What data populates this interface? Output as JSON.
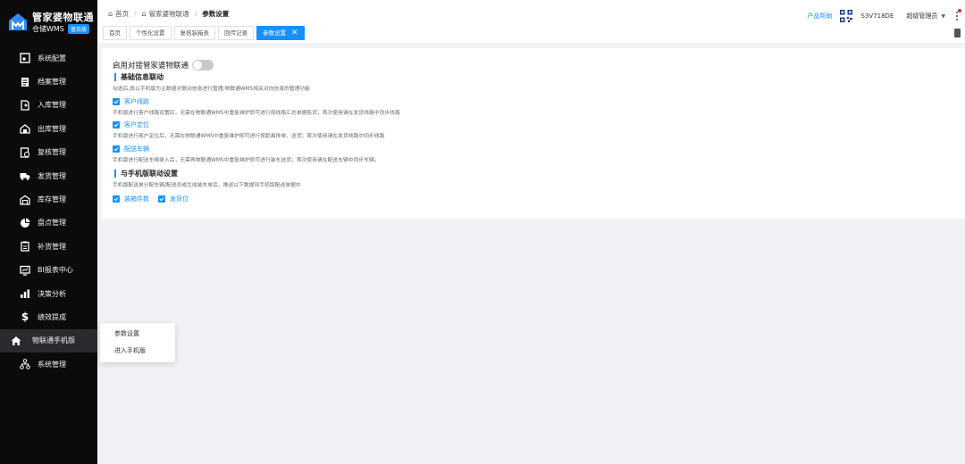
{
  "brand": {
    "title": "管家婆物联通",
    "subtitle": "仓储WMS",
    "badge": "普及版"
  },
  "sidebar": {
    "items": [
      {
        "label": "系统配置",
        "icon": "settings-icon"
      },
      {
        "label": "档案管理",
        "icon": "document-icon"
      },
      {
        "label": "入库管理",
        "icon": "inbound-icon"
      },
      {
        "label": "出库管理",
        "icon": "outbound-icon"
      },
      {
        "label": "复核管理",
        "icon": "review-icon"
      },
      {
        "label": "发货管理",
        "icon": "truck-icon"
      },
      {
        "label": "库存管理",
        "icon": "warehouse-icon"
      },
      {
        "label": "盘点管理",
        "icon": "pie-icon"
      },
      {
        "label": "补货管理",
        "icon": "clipboard-icon"
      },
      {
        "label": "BI报表中心",
        "icon": "report-icon"
      },
      {
        "label": "决策分析",
        "icon": "bar-chart-icon"
      },
      {
        "label": "绩效提成",
        "icon": "dollar-icon"
      },
      {
        "label": "物联通手机版",
        "icon": "home-icon"
      },
      {
        "label": "系统管理",
        "icon": "org-icon"
      }
    ],
    "flyout": [
      "参数设置",
      "进入手机版"
    ]
  },
  "header": {
    "breadcrumbs": [
      "首页",
      "管家婆物联通",
      "参数设置"
    ],
    "tabs": [
      "首页",
      "个性化设置",
      "复核装箱表",
      "回传记录",
      "参数设置"
    ],
    "help": "产品帮助",
    "code": "S3V718DE",
    "user": "超级管理员"
  },
  "settings": {
    "enable_label": "启用对接管家婆物联通",
    "enabled": false,
    "basic_title": "基础信息联动",
    "basic_desc": "勾选后,既以手机版为主数据对联动信息进行管理;物联通WMS相关对向信息的管理功能",
    "options": [
      {
        "label": "客户线路",
        "desc": "手机版进行客户线路设置后，无需在物联通WMS中重复维护即可进行按线路汇总单据拣货；首次使用请在发货线路中同步线路"
      },
      {
        "label": "客户定位",
        "desc": "手机版进行客户定位后，无需在物联通WMS中重复维护即可进行按距离排单、送货；首次使用请在发货线路中同步线路"
      },
      {
        "label": "配送车辆",
        "desc": "手机版进行配送车辆录入后，无需再物联通WMS中重复维护即可进行装车送货；首次使用请在配送车辆中同步车辆。"
      }
    ],
    "mobile_title": "与手机版联动设置",
    "mobile_desc": "手机版配送单分配车辆/配送员或生成装车单后，推送以下数据到手机版配送单据中",
    "mobile_options": [
      "装箱件数",
      "发货位"
    ]
  },
  "colors": {
    "accent": "#1890ff",
    "sidebar_bg": "#0b0b0c"
  }
}
